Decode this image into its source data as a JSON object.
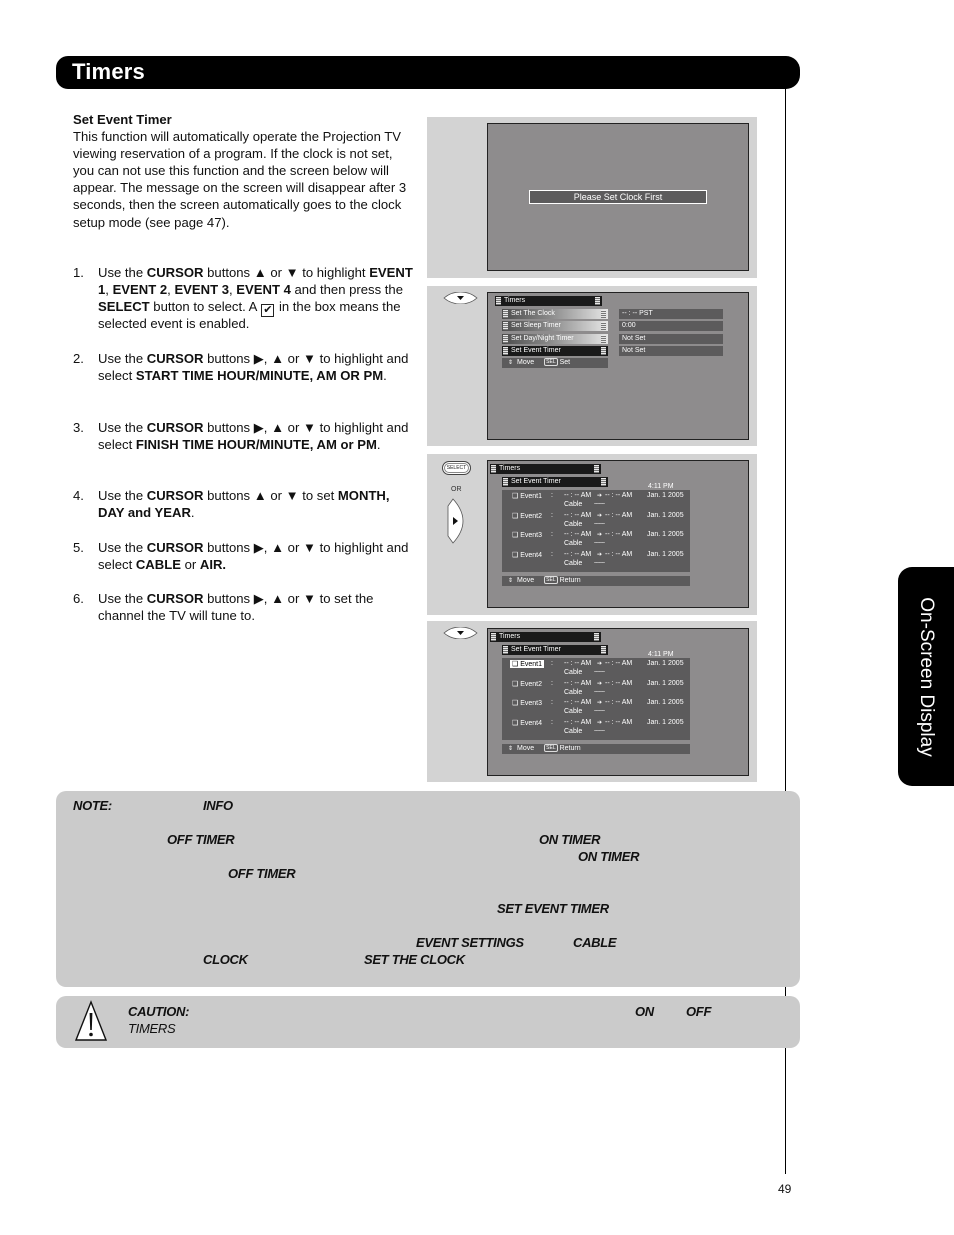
{
  "page": {
    "title": "Timers",
    "side_tab": "On-Screen Display",
    "page_number": "49"
  },
  "intro": {
    "heading": "Set Event Timer",
    "body": "This function will automatically operate the Projection TV viewing reservation of a program. If the clock is not set, you can not use this function and the screen below will appear. The message on the screen will disappear after 3 seconds, then the screen automatically goes to the clock setup mode (see page 47)."
  },
  "steps": [
    {
      "num": "1.",
      "parts": [
        [
          "t",
          "Use the "
        ],
        [
          "b",
          "CURSOR"
        ],
        [
          "t",
          " buttons ▲ or ▼ to highlight "
        ],
        [
          "b",
          "EVENT 1"
        ],
        [
          "t",
          ", "
        ],
        [
          "b",
          "EVENT 2"
        ],
        [
          "t",
          ", "
        ],
        [
          "b",
          "EVENT 3"
        ],
        [
          "t",
          ", "
        ],
        [
          "b",
          "EVENT 4"
        ],
        [
          "t",
          " and then press the "
        ],
        [
          "b",
          "SELECT"
        ],
        [
          "t",
          " button to select.  A "
        ],
        [
          "c",
          "✔"
        ],
        [
          "t",
          " in the box means the selected event is enabled."
        ]
      ]
    },
    {
      "num": "2.",
      "parts": [
        [
          "t",
          "Use the "
        ],
        [
          "b",
          "CURSOR"
        ],
        [
          "t",
          " buttons ▶, ▲ or ▼ to highlight and select "
        ],
        [
          "b",
          "START TIME HOUR/MINUTE, AM OR PM"
        ],
        [
          "t",
          "."
        ]
      ]
    },
    {
      "num": "3.",
      "parts": [
        [
          "t",
          "Use the "
        ],
        [
          "b",
          "CURSOR"
        ],
        [
          "t",
          " buttons ▶, ▲ or ▼ to highlight and select "
        ],
        [
          "b",
          "FINISH TIME HOUR/MINUTE, AM or PM"
        ],
        [
          "t",
          "."
        ]
      ]
    },
    {
      "num": "4.",
      "parts": [
        [
          "t",
          "Use the "
        ],
        [
          "b",
          "CURSOR"
        ],
        [
          "t",
          " buttons ▲ or ▼ to set "
        ],
        [
          "b",
          "MONTH, DAY and YEAR"
        ],
        [
          "t",
          "."
        ]
      ]
    },
    {
      "num": "5.",
      "parts": [
        [
          "t",
          "Use the "
        ],
        [
          "b",
          "CURSOR"
        ],
        [
          "t",
          " buttons ▶, ▲ or ▼ to highlight and select "
        ],
        [
          "b",
          "CABLE"
        ],
        [
          "t",
          " or "
        ],
        [
          "b",
          "AIR."
        ]
      ]
    },
    {
      "num": "6.",
      "parts": [
        [
          "t",
          "Use the "
        ],
        [
          "b",
          "CURSOR"
        ],
        [
          "t",
          " buttons ▶, ▲ or ▼ to set the channel the TV will tune to."
        ]
      ]
    }
  ],
  "screen1": {
    "message": "Please Set Clock First"
  },
  "screen2": {
    "menu_title": "Timers",
    "items": [
      {
        "label": "Set The Clock",
        "value": "-- : --  PST"
      },
      {
        "label": "Set Sleep Timer",
        "value": "0:00"
      },
      {
        "label": "Set Day/Night Timer",
        "value": "Not Set"
      },
      {
        "label": "Set Event Timer",
        "value": "Not Set"
      }
    ],
    "footer_move": "Move",
    "footer_sel": "SEL",
    "footer_action": "Set"
  },
  "event_screen": {
    "menu_title": "Timers",
    "submenu_title": "Set Event Timer",
    "clock": "4:11 PM",
    "events": [
      {
        "name": "❑ Event1",
        "start": "-- : -- AM",
        "finish": "-- : -- AM",
        "date": "Jan. 1 2005",
        "source": "Cable",
        "channel": "-------"
      },
      {
        "name": "❑ Event2",
        "start": "-- : -- AM",
        "finish": "-- : -- AM",
        "date": "Jan. 1 2005",
        "source": "Cable",
        "channel": "-------"
      },
      {
        "name": "❑ Event3",
        "start": "-- : -- AM",
        "finish": "-- : -- AM",
        "date": "Jan. 1 2005",
        "source": "Cable",
        "channel": "-------"
      },
      {
        "name": "❑ Event4",
        "start": "-- : -- AM",
        "finish": "-- : -- AM",
        "date": "Jan. 1 2005",
        "source": "Cable",
        "channel": "-------"
      }
    ],
    "colon": ":",
    "arrow": "➔",
    "footer_move": "Move",
    "footer_sel": "SEL",
    "footer_action": "Return",
    "highlighted_event_screen4": "Event1"
  },
  "remote": {
    "select_label": "SELECT",
    "or_label": "OR"
  },
  "note": {
    "label": "NOTE:",
    "keywords": [
      "INFO",
      "OFF TIMER",
      "ON TIMER",
      "ON TIMER",
      "OFF TIMER",
      "SET EVENT TIMER",
      "EVENT SETTINGS",
      "CABLE",
      "CLOCK",
      "SET THE CLOCK"
    ]
  },
  "caution": {
    "label": "CAUTION:",
    "keywords": [
      "ON",
      "OFF",
      "TIMERS"
    ]
  }
}
